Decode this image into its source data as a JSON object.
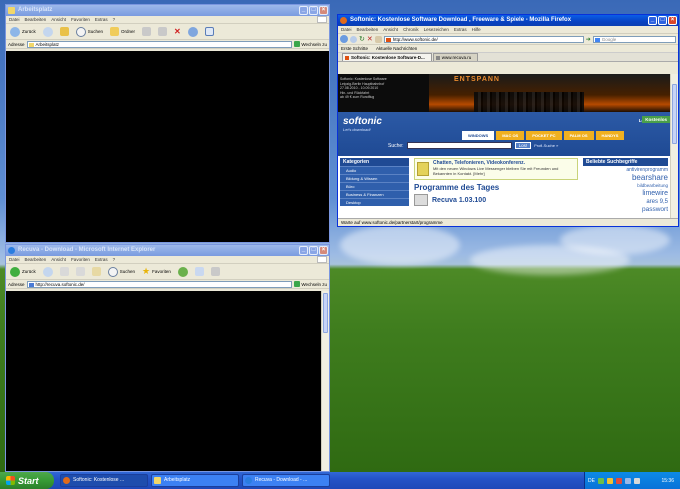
{
  "win_explorer": {
    "title": "Arbeitsplatz",
    "menu": [
      "Datei",
      "Bearbeiten",
      "Ansicht",
      "Favoriten",
      "Extras",
      "?"
    ],
    "toolbar": {
      "back": "Zurück",
      "search": "Suchen",
      "folders": "Ordner"
    },
    "address_label": "Adresse",
    "address_value": "Arbeitsplatz",
    "go_label": "Wechseln zu"
  },
  "win_firefox": {
    "title": "Softonic: Kostenlose Software Download , Freeware & Spiele - Mozilla Firefox",
    "menu": [
      "Datei",
      "Bearbeiten",
      "Ansicht",
      "Chronik",
      "Lesezeichen",
      "Extras",
      "Hilfe"
    ],
    "url": "http://www.softonic.de/",
    "search_placeholder": "Google",
    "bookmarks": [
      "Erste Schritte",
      "Aktuelle Nachrichten"
    ],
    "tabs": [
      "Softonic: Kostenlose Software-D...",
      "www.recuva.ru"
    ],
    "banner_text": "ENTSPANN",
    "banner_lines": [
      "Softonic: Kostenlose Software",
      "Leipzig-Berlin Hauptbahnhof",
      "27.08.2010 - 10.09.2010",
      "Hin- und Rückfahrt",
      "ab 49 € zum Rundflug"
    ],
    "logo": "softonic",
    "slogan": "Let's download!",
    "login": "Login",
    "kostenlos": "Kostenlos",
    "search_label": "Suche:",
    "search_btn": "Los!",
    "adv_search": "Profi-Suche »",
    "platforms": [
      "WINDOWS",
      "MAC OS",
      "POCKET PC",
      "PALM OS",
      "HANDYS"
    ],
    "categories_title": "Kategorien",
    "categories": [
      "Audio",
      "Bildung & Wissen",
      "Büro",
      "Business & Finanzen",
      "Desktop"
    ],
    "chat_title": "Chatten, Telefonieren, Videokonferenz.",
    "chat_desc": "Mit den neuen Windows Live Messenger bleiben Sie mit Freunden und Bekannten in Kontakt. [Mehr]",
    "programs_title": "Programme des Tages",
    "program": "Recuva 1.03.100",
    "popular_title": "Beliebte Suchbegriffe",
    "tags": [
      "antivirenprogramm",
      "bearshare",
      "bildbearbeitung",
      "limewire",
      "ares 9,5",
      "passwort",
      "vista"
    ],
    "status": "Warte auf www.softonic.de/partnerstart/programme"
  },
  "win_ie": {
    "title": "Recuva - Download - Microsoft Internet Explorer",
    "menu": [
      "Datei",
      "Bearbeiten",
      "Ansicht",
      "Favoriten",
      "Extras",
      "?"
    ],
    "toolbar": {
      "back": "Zurück",
      "search": "Suchen",
      "favorites": "Favoriten"
    },
    "address_label": "Adresse",
    "address_value": "http://recuva.softonic.de/",
    "go_label": "Wechseln zu"
  },
  "taskbar": {
    "start": "Start",
    "tasks": [
      "Softonic: Kostenlose ...",
      "Arbeitsplatz",
      "Recuva - Download - ..."
    ],
    "lang": "DE",
    "clock": "15:36"
  }
}
